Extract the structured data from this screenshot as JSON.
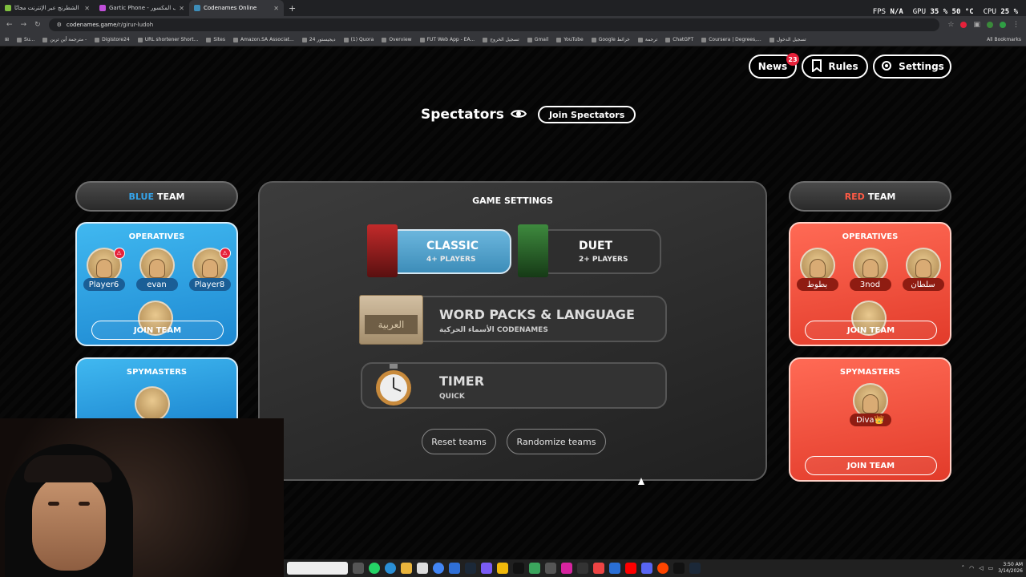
{
  "browser": {
    "tabs": [
      {
        "title": "العب الشطرنج عبر الإنترنت مجانًا",
        "color": "#7fbf3f",
        "active": false
      },
      {
        "title": "Gartic Phone - الهاتف المكسور",
        "color": "#c04fd9",
        "active": false
      },
      {
        "title": "Codenames Online",
        "color": "#3d8db9",
        "active": true
      }
    ],
    "newtab": "+",
    "url_host": "codenames.game",
    "url_path": "/r/girur-ludoh",
    "stats": [
      {
        "label": "FPS",
        "value": "N/A"
      },
      {
        "label": "GPU",
        "value": "35 % 50 °C"
      },
      {
        "label": "CPU",
        "value": "25 %"
      }
    ],
    "bookmarks": [
      "Su...",
      "مترجمة أين ترين -",
      "Digistore24",
      "URL shortener Short...",
      "Sites",
      "Amazon.SA Associat...",
      "ديجيستور 24",
      "(1) Quora",
      "Overview",
      "FUT Web App - EA...",
      "تسجيل الخروج",
      "Gmail",
      "YouTube",
      "Google خرائط",
      "ترجمة",
      "ChatGPT",
      "Coursera | Degrees,...",
      "تسجيل الدخول"
    ],
    "all_bookmarks": "All Bookmarks"
  },
  "topbar": {
    "news_label": "News",
    "news_badge": "23",
    "rules_label": "Rules",
    "settings_label": "Settings"
  },
  "spectators": {
    "title": "Spectators",
    "join_label": "Join Spectators"
  },
  "blue_team": {
    "color_word": "BLUE",
    "team_word": "TEAM",
    "operatives_label": "OPERATIVES",
    "operatives": [
      "Player6",
      "evan",
      "Player8"
    ],
    "join_label": "JOIN TEAM",
    "spymasters_label": "SPYMASTERS"
  },
  "red_team": {
    "color_word": "RED",
    "team_word": "TEAM",
    "operatives_label": "OPERATIVES",
    "operatives": [
      "بطوط",
      "3nod",
      "سلطان"
    ],
    "join_label": "JOIN TEAM",
    "spymasters_label": "SPYMASTERS",
    "spymaster": "Diva👑",
    "spy_join_label": "JOIN TEAM"
  },
  "game_settings": {
    "title": "GAME SETTINGS",
    "classic_label": "CLASSIC",
    "classic_sub": "4+ PLAYERS",
    "duet_label": "DUET",
    "duet_sub": "2+ PLAYERS",
    "wordpacks_label": "WORD PACKS & LANGUAGE",
    "wordpacks_sub": "الأسماء الحركية CODENAMES",
    "wordpacks_box": "العربية",
    "timer_label": "TIMER",
    "timer_sub": "QUICK",
    "reset_label": "Reset teams",
    "randomize_label": "Randomize teams"
  },
  "taskbar": {
    "time": "3:50 AM",
    "date": "3/14/2026"
  },
  "colors": {
    "blue_accent": "#35a4ea",
    "red_accent": "#ff5a45",
    "badge": "#e6213a"
  }
}
